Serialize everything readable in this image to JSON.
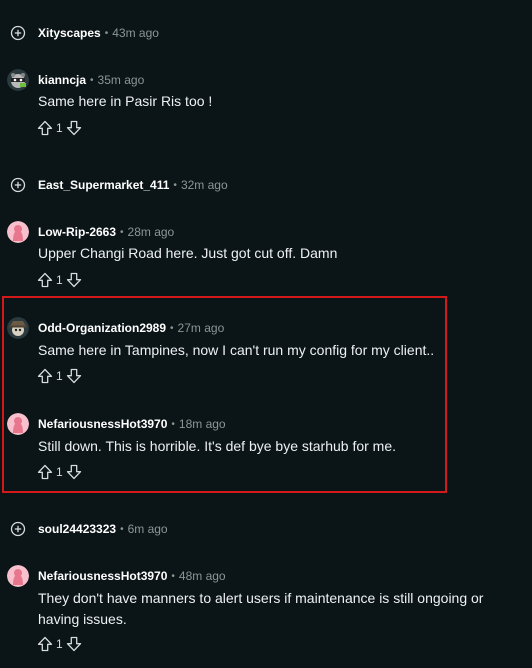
{
  "comments": [
    {
      "username": "Xityscapes",
      "time": "43m ago",
      "collapsed": true
    },
    {
      "username": "kianncja",
      "time": "35m ago",
      "text": "Same here in Pasir Ris too !",
      "score": "1",
      "avatar": "raccoon-avatar"
    },
    {
      "username": "East_Supermarket_411",
      "time": "32m ago",
      "collapsed": true
    },
    {
      "username": "Low-Rip-2663",
      "time": "28m ago",
      "text": "Upper Changi Road here. Just got cut off. Damn",
      "score": "1",
      "avatar": "pink-avatar"
    },
    {
      "username": "Odd-Organization2989",
      "time": "27m ago",
      "text": "Same here in Tampines, now I can't run my config for my client..",
      "score": "1",
      "avatar": "hat-avatar",
      "highlighted": true
    },
    {
      "username": "NefariousnessHot3970",
      "time": "18m ago",
      "text": "Still down. This is horrible. It's def bye bye starhub for me.",
      "score": "1",
      "avatar": "pink-avatar",
      "highlighted": true
    },
    {
      "username": "soul24423323",
      "time": "6m ago",
      "collapsed": true
    },
    {
      "username": "NefariousnessHot3970",
      "time": "48m ago",
      "text_line1": "They don't have manners to alert users if maintenance is still ongoing or",
      "text_line2": "having issues.",
      "score": "1",
      "avatar": "pink-avatar"
    }
  ],
  "separator": "•",
  "colors": {
    "background": "#0b1416",
    "highlight_border": "#d4191b",
    "meta": "#8b9699"
  }
}
